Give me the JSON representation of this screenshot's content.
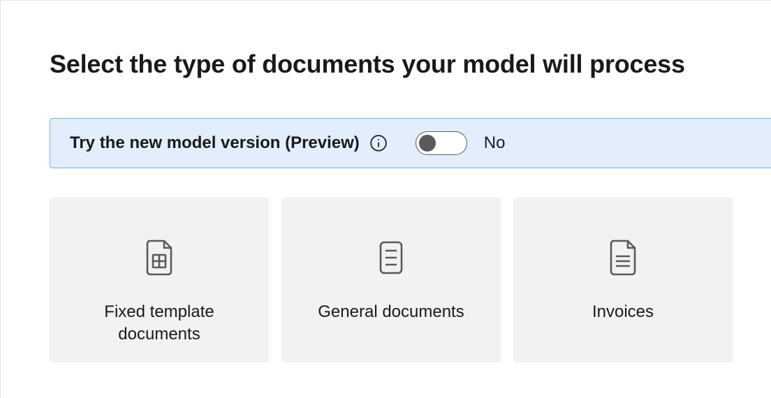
{
  "heading": "Select the type of documents your model will process",
  "preview_banner": {
    "label": "Try the new model version (Preview)",
    "toggle_value": "No"
  },
  "cards": [
    {
      "label": "Fixed template documents"
    },
    {
      "label": "General documents"
    },
    {
      "label": "Invoices"
    }
  ]
}
